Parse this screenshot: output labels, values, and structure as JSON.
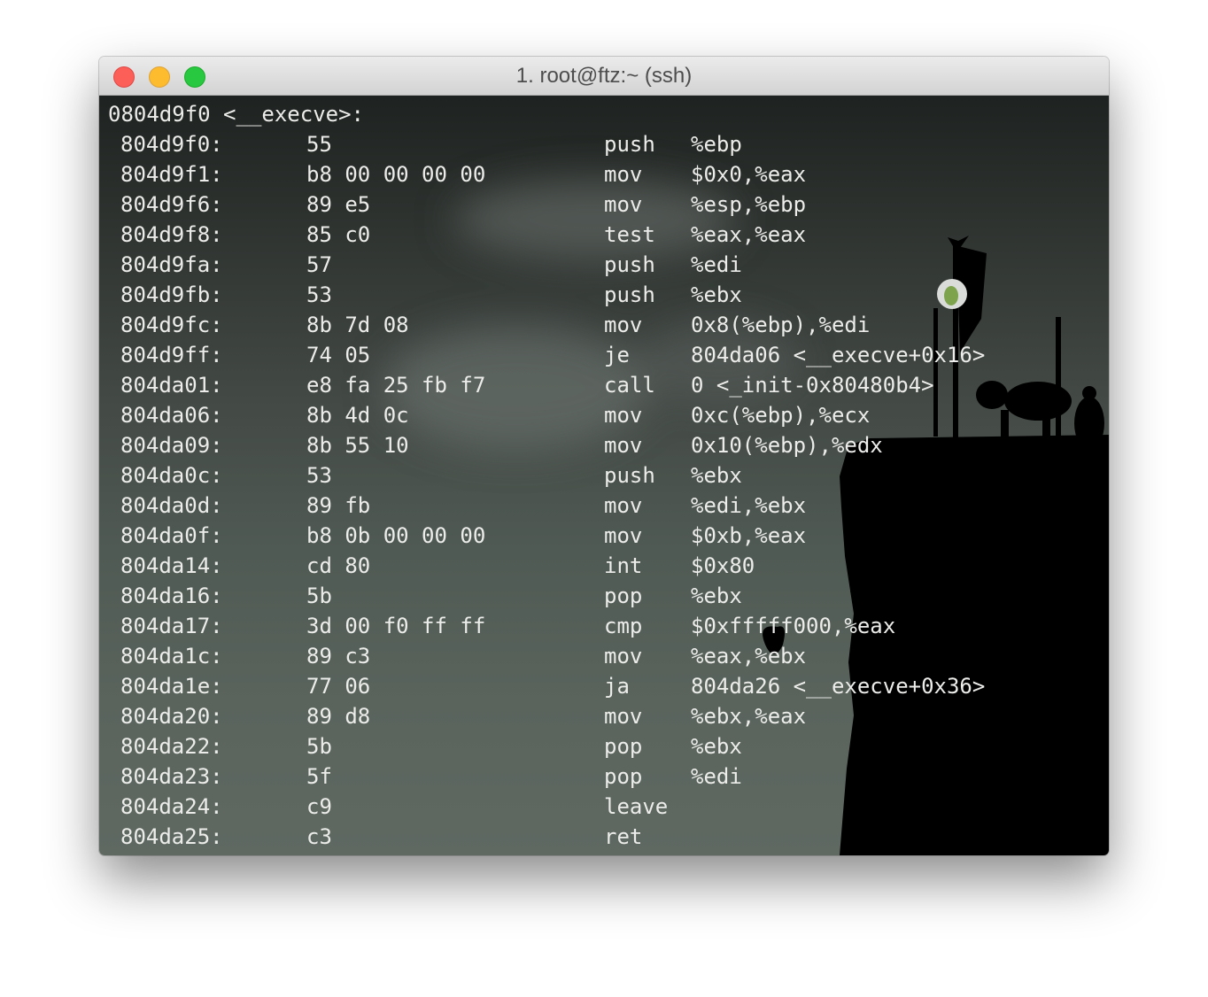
{
  "window": {
    "title": "1. root@ftz:~ (ssh)"
  },
  "terminal": {
    "header": "0804d9f0 <__execve>:",
    "rows": [
      {
        "addr": "804d9f0:",
        "hex": "55",
        "mnemonic": "push",
        "operands": "%ebp"
      },
      {
        "addr": "804d9f1:",
        "hex": "b8 00 00 00 00",
        "mnemonic": "mov",
        "operands": "$0x0,%eax"
      },
      {
        "addr": "804d9f6:",
        "hex": "89 e5",
        "mnemonic": "mov",
        "operands": "%esp,%ebp"
      },
      {
        "addr": "804d9f8:",
        "hex": "85 c0",
        "mnemonic": "test",
        "operands": "%eax,%eax"
      },
      {
        "addr": "804d9fa:",
        "hex": "57",
        "mnemonic": "push",
        "operands": "%edi"
      },
      {
        "addr": "804d9fb:",
        "hex": "53",
        "mnemonic": "push",
        "operands": "%ebx"
      },
      {
        "addr": "804d9fc:",
        "hex": "8b 7d 08",
        "mnemonic": "mov",
        "operands": "0x8(%ebp),%edi"
      },
      {
        "addr": "804d9ff:",
        "hex": "74 05",
        "mnemonic": "je",
        "operands": "804da06 <__execve+0x16>"
      },
      {
        "addr": "804da01:",
        "hex": "e8 fa 25 fb f7",
        "mnemonic": "call",
        "operands": "0 <_init-0x80480b4>"
      },
      {
        "addr": "804da06:",
        "hex": "8b 4d 0c",
        "mnemonic": "mov",
        "operands": "0xc(%ebp),%ecx"
      },
      {
        "addr": "804da09:",
        "hex": "8b 55 10",
        "mnemonic": "mov",
        "operands": "0x10(%ebp),%edx"
      },
      {
        "addr": "804da0c:",
        "hex": "53",
        "mnemonic": "push",
        "operands": "%ebx"
      },
      {
        "addr": "804da0d:",
        "hex": "89 fb",
        "mnemonic": "mov",
        "operands": "%edi,%ebx"
      },
      {
        "addr": "804da0f:",
        "hex": "b8 0b 00 00 00",
        "mnemonic": "mov",
        "operands": "$0xb,%eax"
      },
      {
        "addr": "804da14:",
        "hex": "cd 80",
        "mnemonic": "int",
        "operands": "$0x80"
      },
      {
        "addr": "804da16:",
        "hex": "5b",
        "mnemonic": "pop",
        "operands": "%ebx"
      },
      {
        "addr": "804da17:",
        "hex": "3d 00 f0 ff ff",
        "mnemonic": "cmp",
        "operands": "$0xfffff000,%eax"
      },
      {
        "addr": "804da1c:",
        "hex": "89 c3",
        "mnemonic": "mov",
        "operands": "%eax,%ebx"
      },
      {
        "addr": "804da1e:",
        "hex": "77 06",
        "mnemonic": "ja",
        "operands": "804da26 <__execve+0x36>"
      },
      {
        "addr": "804da20:",
        "hex": "89 d8",
        "mnemonic": "mov",
        "operands": "%ebx,%eax"
      },
      {
        "addr": "804da22:",
        "hex": "5b",
        "mnemonic": "pop",
        "operands": "%ebx"
      },
      {
        "addr": "804da23:",
        "hex": "5f",
        "mnemonic": "pop",
        "operands": "%edi"
      },
      {
        "addr": "804da24:",
        "hex": "c9",
        "mnemonic": "leave",
        "operands": ""
      },
      {
        "addr": "804da25:",
        "hex": "c3",
        "mnemonic": "ret",
        "operands": ""
      }
    ]
  }
}
